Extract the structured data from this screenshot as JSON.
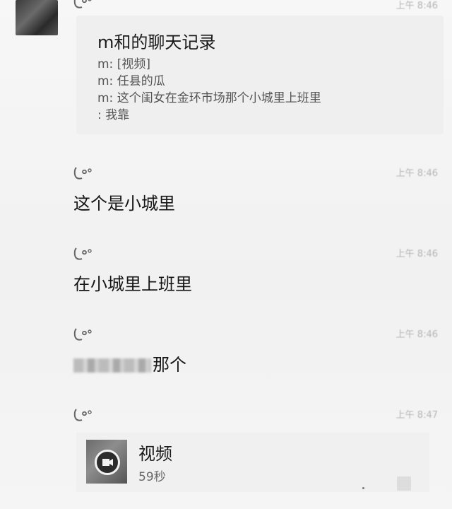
{
  "forward_card": {
    "title": "m和的聊天记录",
    "lines": [
      "m: [视频]",
      "m: 任县的瓜",
      "m: 这个闺女在金环市场那个小城里上班里",
      ": 我靠"
    ]
  },
  "messages": [
    {
      "time": "上午 8:46",
      "text": "这个是小城里"
    },
    {
      "time": "上午 8:46",
      "text": "在小城里上班里"
    },
    {
      "time": "上午 8:46",
      "text": "那个"
    },
    {
      "time": "上午 8:47",
      "text": ""
    }
  ],
  "video": {
    "title": "视频",
    "duration": "59秒"
  },
  "icons": {
    "sender": "wechat-sender-icon",
    "play": "video-play-icon"
  },
  "colors": {
    "background": "#f3f3f3",
    "card": "#efefef",
    "timestamp": "#b5b5b5"
  }
}
